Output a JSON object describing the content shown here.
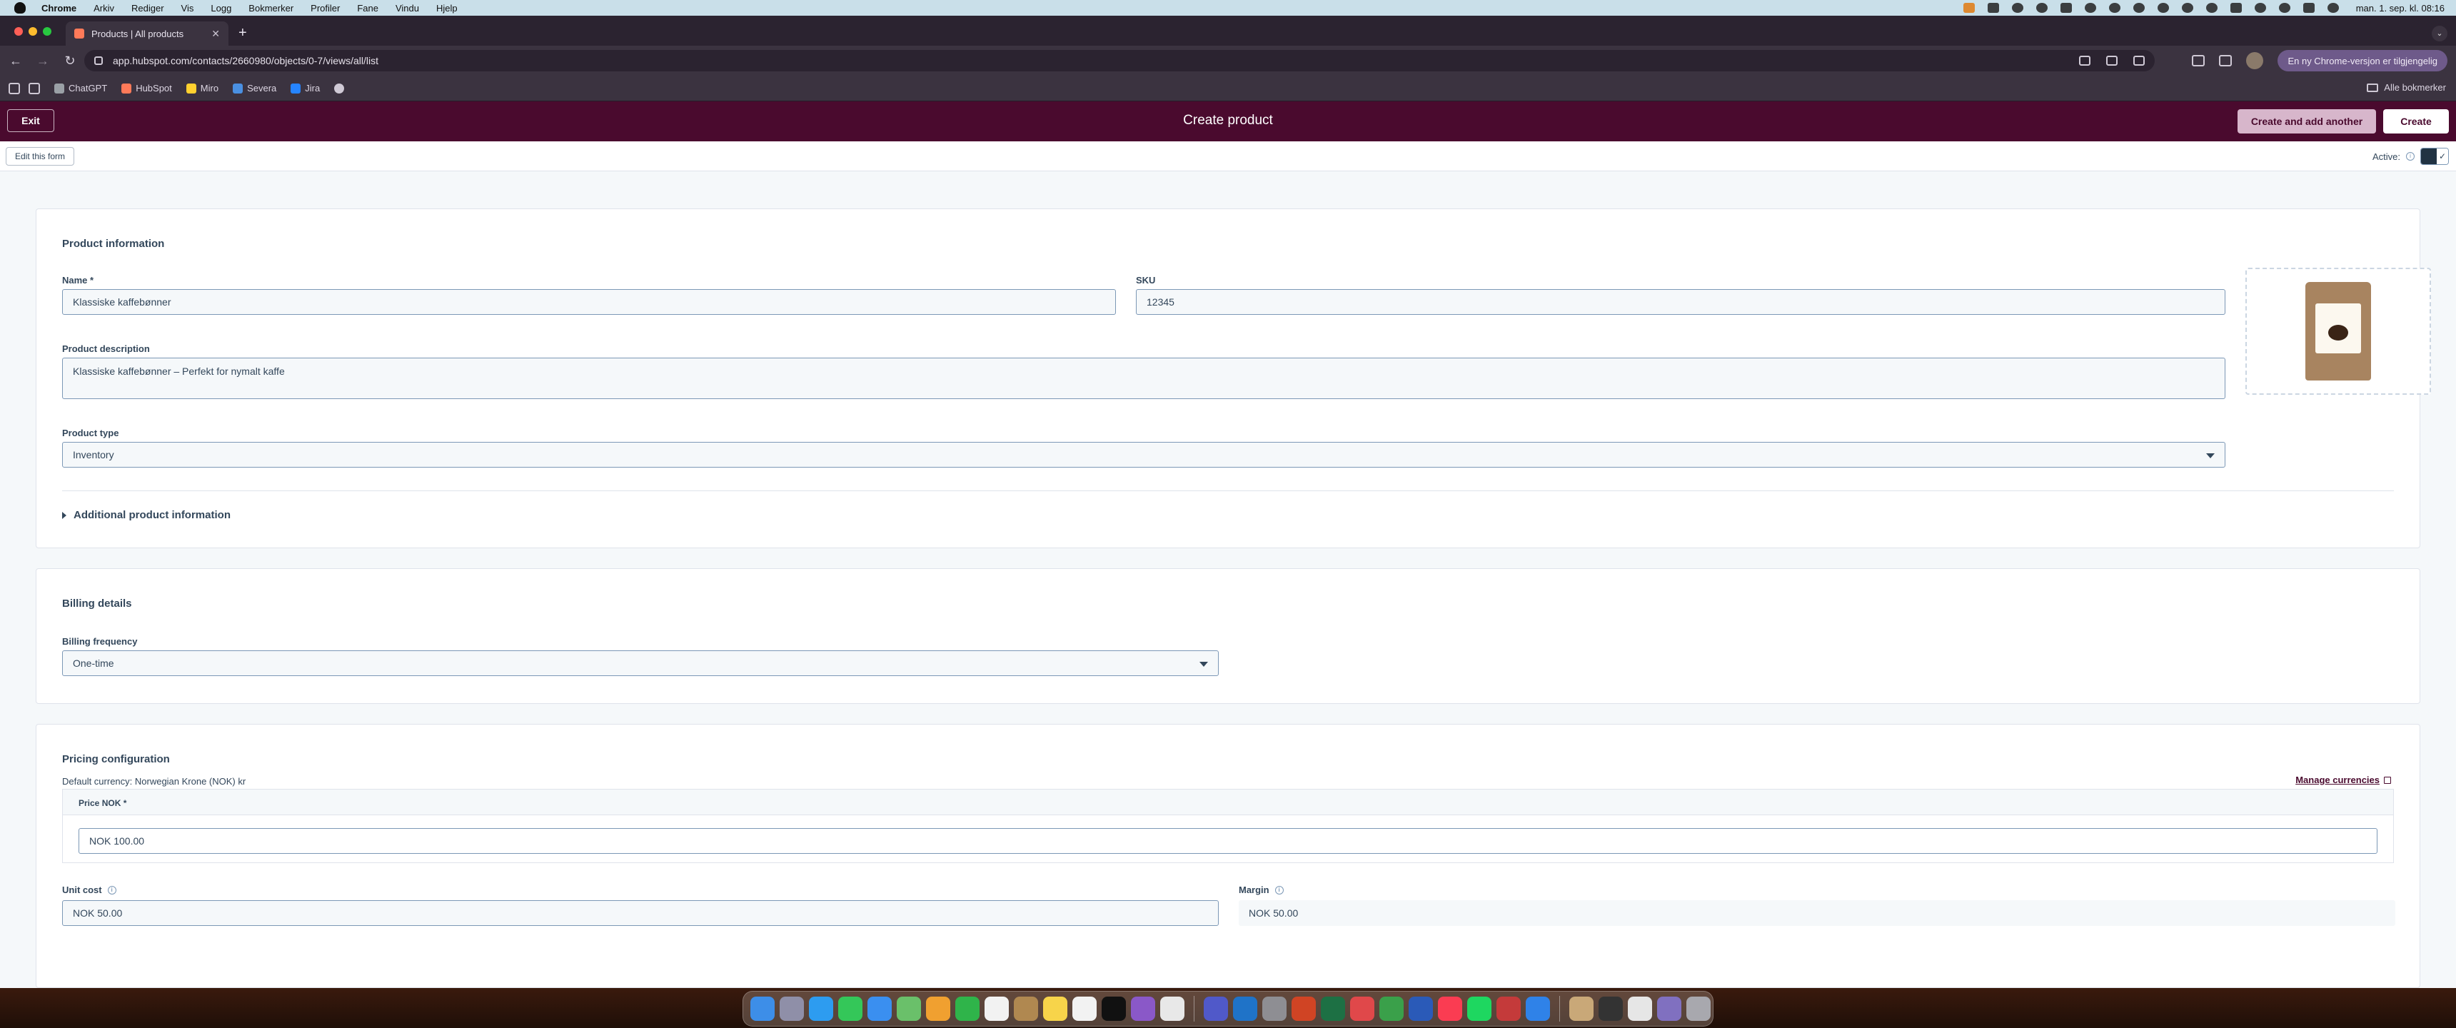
{
  "menubar": {
    "app": "Chrome",
    "items": [
      "Arkiv",
      "Rediger",
      "Vis",
      "Logg",
      "Bokmerker",
      "Profiler",
      "Fane",
      "Vindu",
      "Hjelp"
    ],
    "clock": "man. 1. sep. kl. 08:16"
  },
  "browser": {
    "tab_title": "Products | All products",
    "url": "app.hubspot.com/contacts/2660980/objects/0-7/views/all/list",
    "update_label": "En ny Chrome-versjon er tilgjengelig",
    "bookmarks": [
      {
        "label": "ChatGPT",
        "color": "#9aa0a6"
      },
      {
        "label": "HubSpot",
        "color": "#ff7a59"
      },
      {
        "label": "Miro",
        "color": "#ffd02f"
      },
      {
        "label": "Severa",
        "color": "#4a90e2"
      },
      {
        "label": "Jira",
        "color": "#2684ff"
      }
    ],
    "all_bookmarks": "Alle bokmerker"
  },
  "header": {
    "exit": "Exit",
    "title": "Create product",
    "create_another": "Create and add another",
    "create": "Create"
  },
  "subbar": {
    "edit_form": "Edit this form",
    "active_label": "Active:",
    "active": true
  },
  "product_info": {
    "heading": "Product information",
    "name_label": "Name *",
    "name_value": "Klassiske kaffebønner",
    "sku_label": "SKU",
    "sku_value": "12345",
    "desc_label": "Product description",
    "desc_value": "Klassiske kaffebønner – Perfekt for nymalt kaffe",
    "type_label": "Product type",
    "type_value": "Inventory",
    "additional": "Additional product information"
  },
  "billing": {
    "heading": "Billing details",
    "freq_label": "Billing frequency",
    "freq_value": "One-time"
  },
  "pricing": {
    "heading": "Pricing configuration",
    "currency": "Default currency: Norwegian Krone (NOK) kr",
    "manage": "Manage currencies",
    "price_label": "Price NOK *",
    "price_value": "NOK 100.00",
    "unit_cost_label": "Unit cost",
    "unit_cost_value": "NOK 50.00",
    "margin_label": "Margin",
    "margin_value": "NOK 50.00"
  },
  "colors": {
    "brand": "#4a0a2e",
    "secondary_button": "#d7b6cb",
    "text": "#33475b"
  },
  "dock_apps": [
    "finder",
    "launchpad",
    "safari",
    "messages",
    "mail",
    "maps",
    "photos",
    "facetime",
    "calendar",
    "notes",
    "reminders",
    "tv",
    "podcasts",
    "chrome",
    "teams",
    "outlook",
    "settings",
    "powerpoint",
    "excel",
    "word",
    "onenote",
    "music",
    "spotify",
    "dictionary",
    "xcode",
    "preview",
    "terminal",
    "downloads",
    "trash"
  ]
}
